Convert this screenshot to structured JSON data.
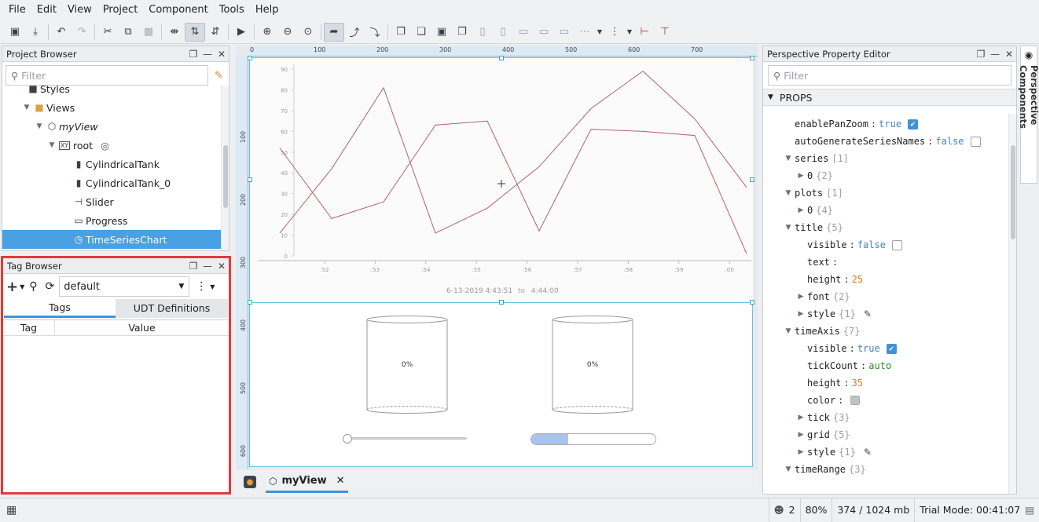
{
  "menu": [
    "File",
    "Edit",
    "View",
    "Project",
    "Component",
    "Tools",
    "Help"
  ],
  "project_browser": {
    "title": "Project Browser",
    "filter_placeholder": "Filter",
    "items": [
      {
        "label": "Styles",
        "icon": "styles-icon"
      },
      {
        "label": "Views",
        "icon": "folder-icon"
      },
      {
        "label": "myView",
        "icon": "view-cube-icon"
      },
      {
        "label": "root",
        "icon": "xy-container-icon"
      },
      {
        "label": "CylindricalTank",
        "icon": "tank-icon"
      },
      {
        "label": "CylindricalTank_0",
        "icon": "tank-icon"
      },
      {
        "label": "Slider",
        "icon": "slider-icon"
      },
      {
        "label": "Progress",
        "icon": "progress-icon"
      },
      {
        "label": "TimeSeriesChart",
        "icon": "chart-icon"
      }
    ]
  },
  "tag_browser": {
    "title": "Tag Browser",
    "provider": "default",
    "tabs": [
      "Tags",
      "UDT Definitions"
    ],
    "columns": [
      "Tag",
      "Value"
    ]
  },
  "designer": {
    "ruler_h": [
      "0",
      "100",
      "200",
      "300",
      "400",
      "500",
      "600",
      "700"
    ],
    "ruler_v": [
      "100",
      "200",
      "300",
      "400",
      "500",
      "600"
    ],
    "tab_label": "myView",
    "tank_pct": [
      "0%",
      "0%"
    ],
    "progress_value": 0.3
  },
  "chart_data": {
    "type": "line",
    "x": [
      ":51.5",
      ":52.5",
      ":53.5",
      ":54.5",
      ":55.5",
      ":56.5",
      ":57.5",
      ":58.5",
      ":59.5",
      ":00.5"
    ],
    "tick_labels": [
      ":52",
      ":53",
      ":54",
      ":55",
      ":56",
      ":57",
      ":58",
      ":59",
      ":00"
    ],
    "series": [
      {
        "values": [
          11,
          42,
          81,
          11,
          23,
          43,
          71,
          89,
          66,
          33
        ]
      },
      {
        "values": [
          52,
          18,
          26,
          63,
          65,
          12,
          61,
          60,
          58,
          1
        ]
      }
    ],
    "ylim": [
      0,
      90
    ],
    "yticks": [
      "0",
      "10",
      "20",
      "30",
      "40",
      "50",
      "60",
      "70",
      "80",
      "90"
    ],
    "range_start": "6-13-2019   4:43:51",
    "range_to": "to",
    "range_end": "4:44:00",
    "color": "#b5636a"
  },
  "property_editor": {
    "title": "Perspective Property Editor",
    "filter_placeholder": "Filter",
    "section": "PROPS",
    "side_tab": "Perspective Components",
    "rows": [
      {
        "key": "enablePanZoom",
        "val": "true",
        "kind": "b",
        "check": true,
        "indent": 0
      },
      {
        "key": "autoGenerateSeriesNames",
        "val": "false",
        "kind": "b",
        "check": false,
        "indent": 0
      },
      {
        "key": "series",
        "meta": "[1]",
        "exp": "open",
        "indent": 0
      },
      {
        "key": "0",
        "meta": "{2}",
        "exp": "closed",
        "indent": 1
      },
      {
        "key": "plots",
        "meta": "[1]",
        "exp": "open",
        "indent": 0
      },
      {
        "key": "0",
        "meta": "{4}",
        "exp": "closed",
        "indent": 1
      },
      {
        "key": "title",
        "meta": "{5}",
        "exp": "open",
        "indent": 0
      },
      {
        "key": "visible",
        "val": "false",
        "kind": "b",
        "check": false,
        "indent": 1
      },
      {
        "key": "text",
        "val": "",
        "kind": "s",
        "indent": 1
      },
      {
        "key": "height",
        "val": "25",
        "kind": "n",
        "indent": 1
      },
      {
        "key": "font",
        "meta": "{2}",
        "exp": "closed",
        "indent": 1
      },
      {
        "key": "style",
        "meta": "{1}",
        "exp": "closed",
        "brush": true,
        "indent": 1
      },
      {
        "key": "timeAxis",
        "meta": "{7}",
        "exp": "open",
        "indent": 0
      },
      {
        "key": "visible",
        "val": "true",
        "kind": "b",
        "check": true,
        "indent": 1
      },
      {
        "key": "tickCount",
        "val": "auto",
        "kind": "s",
        "indent": 1
      },
      {
        "key": "height",
        "val": "35",
        "kind": "n",
        "indent": 1
      },
      {
        "key": "color",
        "val": "",
        "kind": "c",
        "indent": 1
      },
      {
        "key": "tick",
        "meta": "{3}",
        "exp": "closed",
        "indent": 1
      },
      {
        "key": "grid",
        "meta": "{5}",
        "exp": "closed",
        "indent": 1
      },
      {
        "key": "style",
        "meta": "{1}",
        "exp": "closed",
        "brush": true,
        "indent": 1
      },
      {
        "key": "timeRange",
        "meta": "{3}",
        "exp": "open",
        "indent": 0
      }
    ]
  },
  "status": {
    "users": "2",
    "zoom": "80%",
    "memory": "374 / 1024 mb",
    "trial": "Trial Mode: 00:41:07"
  }
}
